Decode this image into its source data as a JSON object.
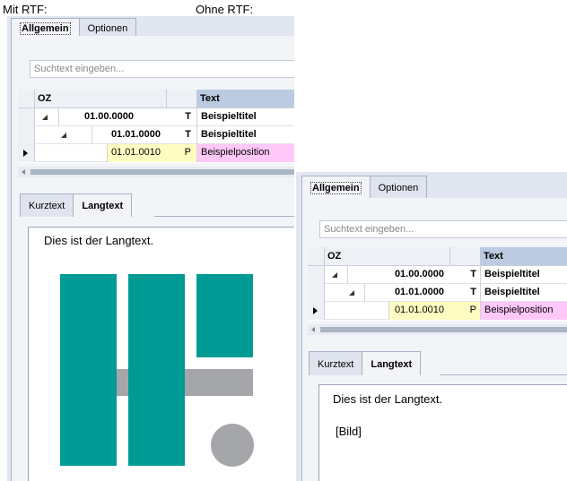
{
  "captions": {
    "left": "Mit RTF:",
    "right": "Ohne RTF:"
  },
  "tabs": {
    "general": "Allgemein",
    "options": "Optionen"
  },
  "search": {
    "placeholder": "Suchtext eingeben..."
  },
  "grid": {
    "headers": {
      "oz": "OZ",
      "text": "Text"
    },
    "rows": [
      {
        "oz": "01.00.0000",
        "type": "T",
        "text": "Beispieltitel"
      },
      {
        "oz": "01.01.0000",
        "type": "T",
        "text": "Beispieltitel"
      },
      {
        "oz": "01.01.0010",
        "type": "P",
        "text": "Beispielposition"
      }
    ]
  },
  "subtabs": {
    "short": "Kurztext",
    "long": "Langtext"
  },
  "longtext": {
    "text": "Dies ist der Langtext.",
    "image_placeholder": "[Bild]"
  },
  "colors": {
    "teal": "#009b95",
    "gray": "#a4a6a9",
    "header_blue": "#bccbe1",
    "position_pink": "#ffc8f8",
    "oz_yellow": "#fffcc2"
  }
}
